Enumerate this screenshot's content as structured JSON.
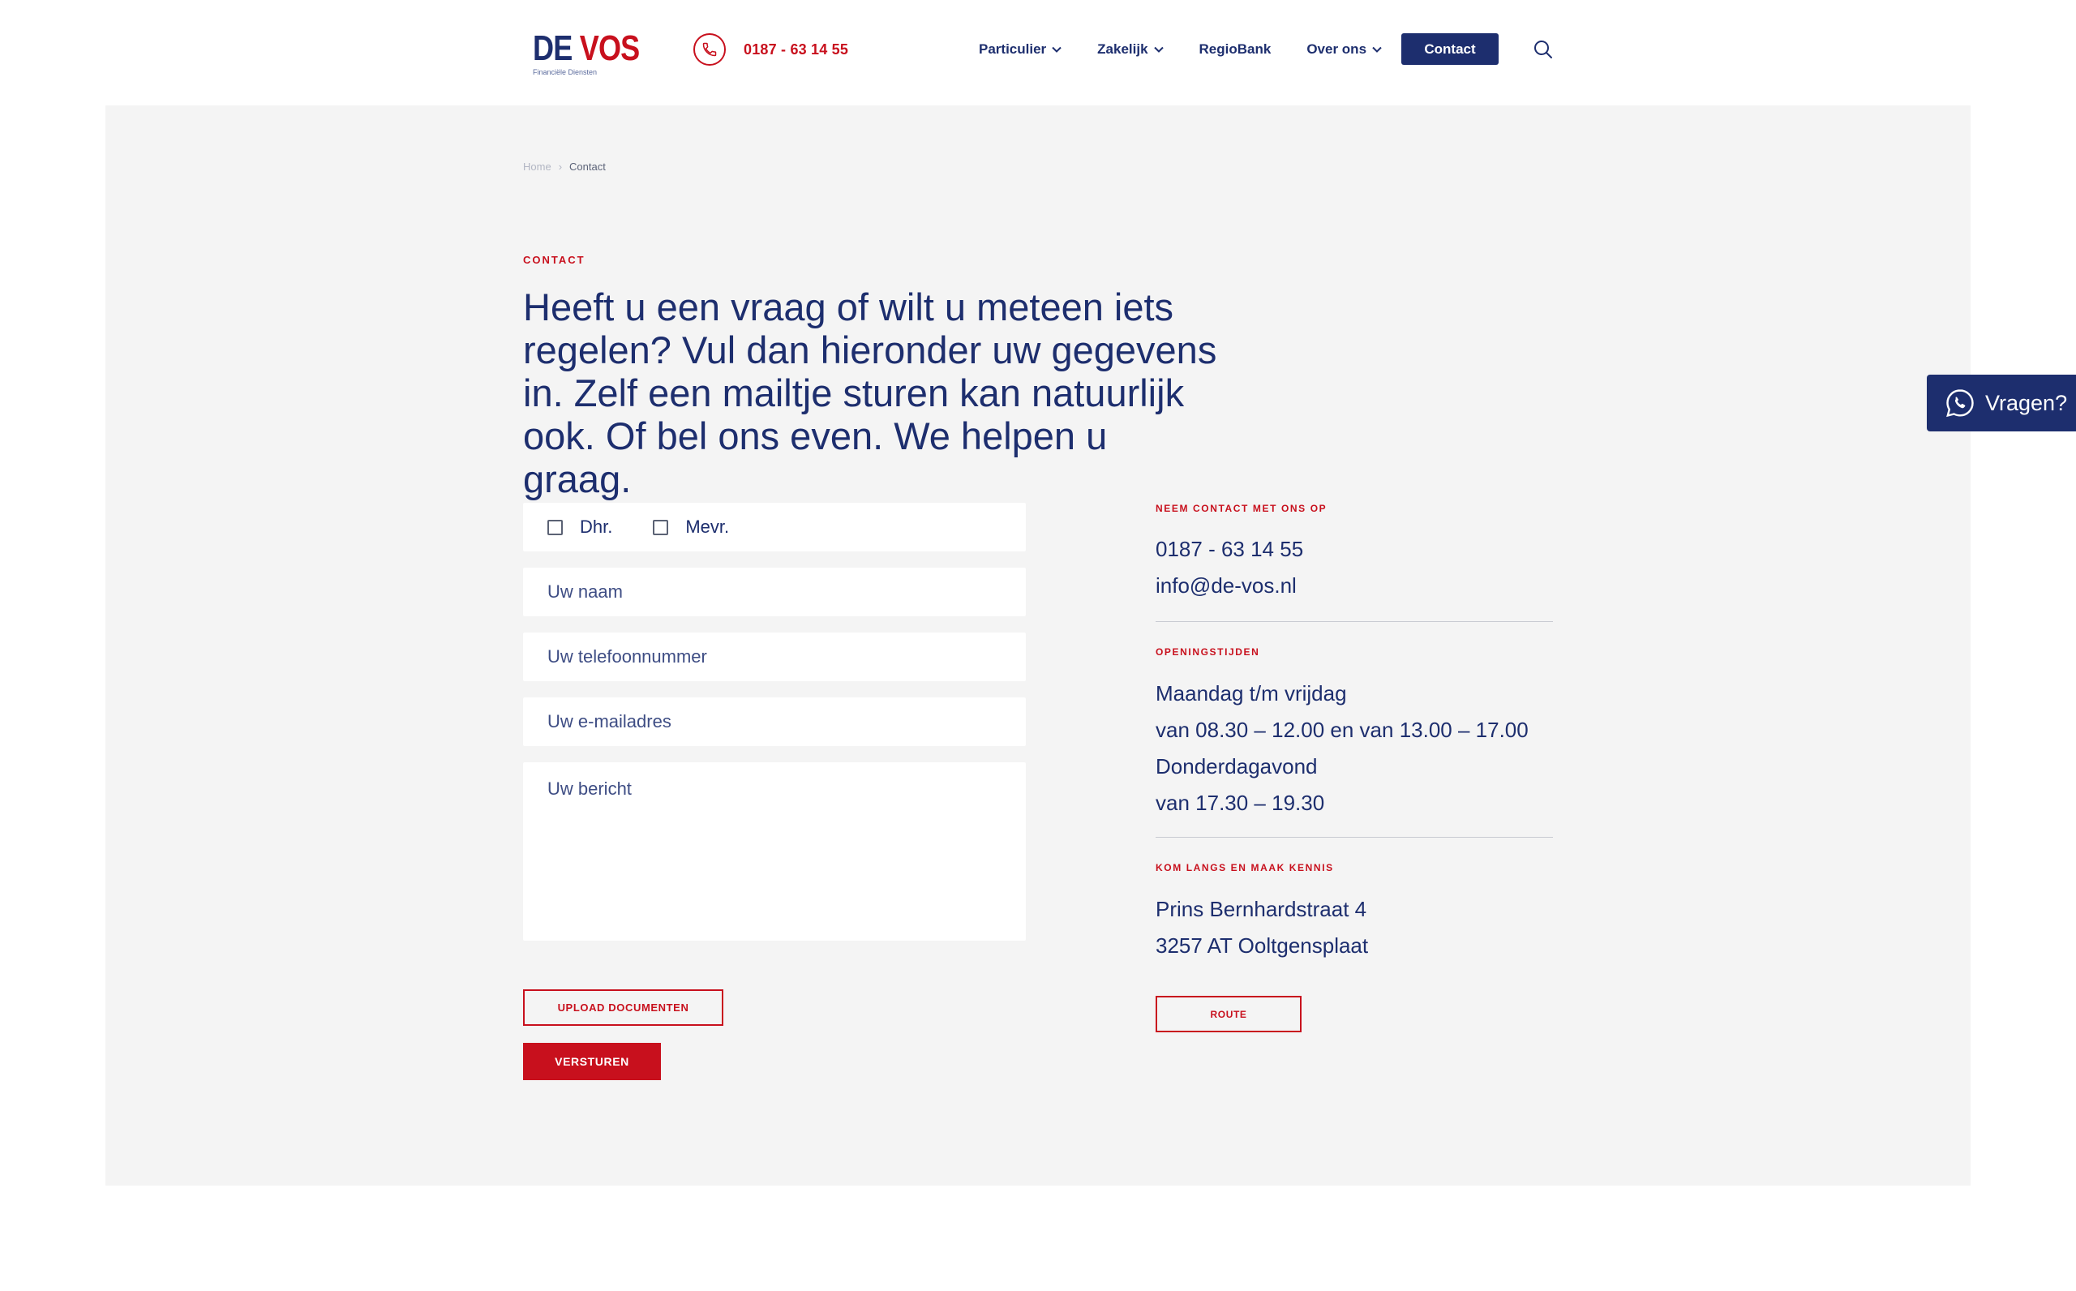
{
  "header": {
    "logo": {
      "word_de": "DE",
      "word_vos": "VOS",
      "subtitle": "Financiële Diensten"
    },
    "phone": "0187 - 63 14 55",
    "nav": [
      {
        "label": "Particulier",
        "dropdown": true
      },
      {
        "label": "Zakelijk",
        "dropdown": true
      },
      {
        "label": "RegioBank",
        "dropdown": false
      },
      {
        "label": "Over ons",
        "dropdown": true
      }
    ],
    "contact_button": "Contact",
    "search_icon": "search-icon"
  },
  "breadcrumb": {
    "home": "Home",
    "separator": "›",
    "current": "Contact"
  },
  "main": {
    "eyebrow": "CONTACT",
    "intro": "Heeft u een vraag of wilt u meteen iets regelen? Vul dan hieronder uw gegevens in. Zelf een mailtje sturen kan natuurlijk ook. Of bel ons even. We helpen u graag."
  },
  "form": {
    "salutation": [
      {
        "label": "Dhr.",
        "checked": false
      },
      {
        "label": "Mevr.",
        "checked": false
      }
    ],
    "name_placeholder": "Uw naam",
    "phone_placeholder": "Uw telefoonnummer",
    "email_placeholder": "Uw e-mailadres",
    "message_placeholder": "Uw bericht",
    "upload_label": "UPLOAD DOCUMENTEN",
    "submit_label": "VERSTUREN"
  },
  "contact_info": {
    "label": "NEEM CONTACT MET ONS OP",
    "phone": "0187 - 63 14 55",
    "email": "info@de-vos.nl"
  },
  "opening_hours": {
    "label": "OPENINGSTIJDEN",
    "lines": [
      "Maandag t/m vrijdag",
      "van 08.30 – 12.00 en van 13.00 – 17.00",
      "Donderdagavond",
      "van 17.30 – 19.30"
    ]
  },
  "visit": {
    "label": "KOM LANGS EN MAAK KENNIS",
    "street": "Prins Bernhardstraat 4",
    "city": "3257 AT Ooltgensplaat",
    "route_label": "ROUTE"
  },
  "whatsapp": {
    "label": "Vragen?",
    "icon": "whatsapp-icon"
  },
  "colors": {
    "brand_blue": "#1d2e6e",
    "brand_red": "#c8101d",
    "panel_bg": "#f4f4f4"
  }
}
